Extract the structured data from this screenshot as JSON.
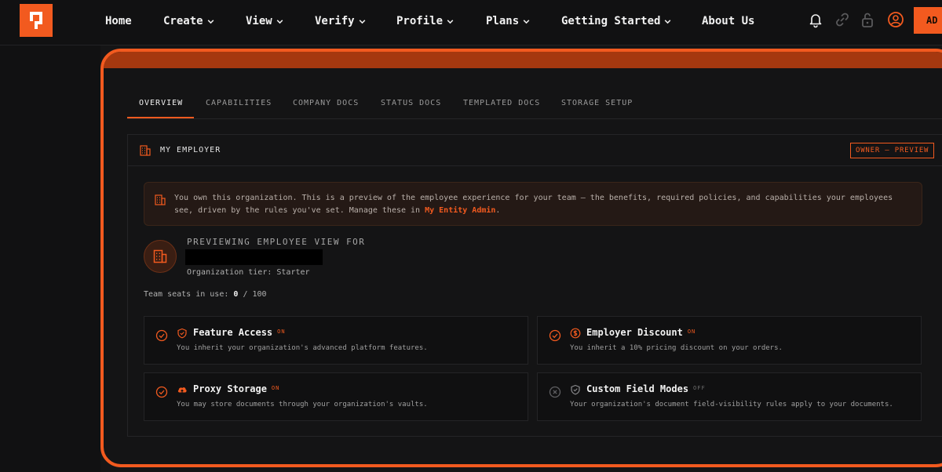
{
  "nav": {
    "items": [
      {
        "label": "Home",
        "dropdown": false
      },
      {
        "label": "Create",
        "dropdown": true
      },
      {
        "label": "View",
        "dropdown": true
      },
      {
        "label": "Verify",
        "dropdown": true
      },
      {
        "label": "Profile",
        "dropdown": true
      },
      {
        "label": "Plans",
        "dropdown": true
      },
      {
        "label": "Getting Started",
        "dropdown": true
      },
      {
        "label": "About Us",
        "dropdown": false
      }
    ],
    "icons": [
      "bell-icon",
      "link-icon",
      "unlock-icon",
      "user-icon"
    ],
    "cta_label": "AD"
  },
  "tabs": [
    {
      "label": "OVERVIEW",
      "active": true
    },
    {
      "label": "CAPABILITIES",
      "active": false
    },
    {
      "label": "COMPANY DOCS",
      "active": false
    },
    {
      "label": "STATUS DOCS",
      "active": false
    },
    {
      "label": "TEMPLATED DOCS",
      "active": false
    },
    {
      "label": "STORAGE SETUP",
      "active": false
    }
  ],
  "card": {
    "title": "MY EMPLOYER",
    "badge": "OWNER — PREVIEW",
    "notice_text": "You own this organization. This is a preview of the employee experience for your team — the benefits, required policies, and capabilities your employees see, driven by the rules you've set. Manage these in ",
    "notice_link": "My Entity Admin",
    "notice_end": ".",
    "preview_label": "PREVIEWING EMPLOYEE VIEW FOR",
    "org_tier": "Organization tier: Starter",
    "seats_label": "Team seats in use: ",
    "seats_used": "0",
    "seats_total": " / 100"
  },
  "features": [
    {
      "title": "Feature Access",
      "state": "ON",
      "desc": "You inherit your organization's advanced platform features.",
      "icon": "shield-icon",
      "enabled": true
    },
    {
      "title": "Employer Discount",
      "state": "ON",
      "desc": "You inherit a 10% pricing discount on your orders.",
      "icon": "dollar-icon",
      "enabled": true
    },
    {
      "title": "Proxy Storage",
      "state": "ON",
      "desc": "You may store documents through your organization's vaults.",
      "icon": "cloud-upload-icon",
      "enabled": true
    },
    {
      "title": "Custom Field Modes",
      "state": "OFF",
      "desc": "Your organization's document field-visibility rules apply to your documents.",
      "icon": "shield-icon",
      "enabled": false
    }
  ],
  "colors": {
    "accent": "#f25a1f",
    "background": "#151516",
    "card": "#101011"
  }
}
